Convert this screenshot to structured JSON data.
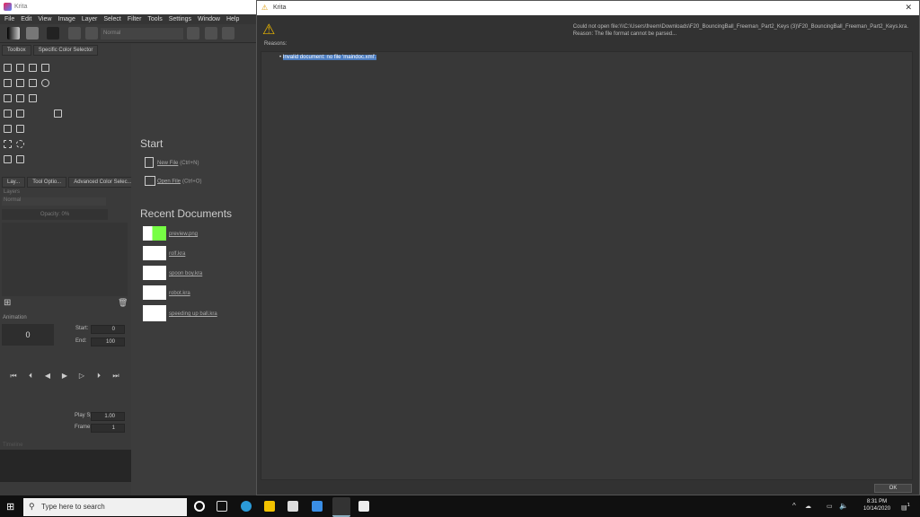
{
  "main": {
    "title": "Krita",
    "menu": [
      "File",
      "Edit",
      "View",
      "Image",
      "Layer",
      "Select",
      "Filter",
      "Tools",
      "Settings",
      "Window",
      "Help"
    ],
    "blend_mode": "Normal",
    "dock_tabs": [
      "Toolbox",
      "Specific Color Selector"
    ],
    "layer_tabs": [
      "Lay...",
      "Tool Optio...",
      "Advanced Color Selec..."
    ],
    "layers": {
      "title": "Layers",
      "blend": "Normal",
      "opacity": "Opacity:  0%"
    },
    "animation": {
      "title": "Animation",
      "frame": "0",
      "start_label": "Start:",
      "start": "0",
      "end_label": "End:",
      "end": "100",
      "speed_label": "Play Speed:",
      "speed": "1.00",
      "rate_label": "Frame Rate:",
      "rate": "1"
    },
    "timeline": "Timeline",
    "start": {
      "heading": "Start",
      "new_file": "New File",
      "new_sc": "(Ctrl+N)",
      "open_file": "Open File",
      "open_sc": "(Ctrl+O)"
    },
    "recent": {
      "heading": "Recent Documents",
      "items": [
        "preview.png",
        "rolf.kra",
        "spoon boy.kra",
        "robot.kra",
        "speeding up ball.kra"
      ]
    }
  },
  "dialog": {
    "title": "Krita",
    "message": "Could not open file:\\\\\\C:\\Users\\freem\\Downloads\\F20_BouncingBall_Freeman_Part2_Keys (3)\\F20_BouncingBall_Freeman_Part2_Keys.kra.",
    "reason_line": "Reason: The file format cannot be parsed...",
    "reasons_label": "Reasons:",
    "reason": "Invalid document: no file 'maindoc.xml'.",
    "ok": "OK",
    "close": "✕"
  },
  "taskbar": {
    "search": "Type here to search",
    "time": "8:31 PM",
    "date": "10/14/2020",
    "notif": "1"
  }
}
